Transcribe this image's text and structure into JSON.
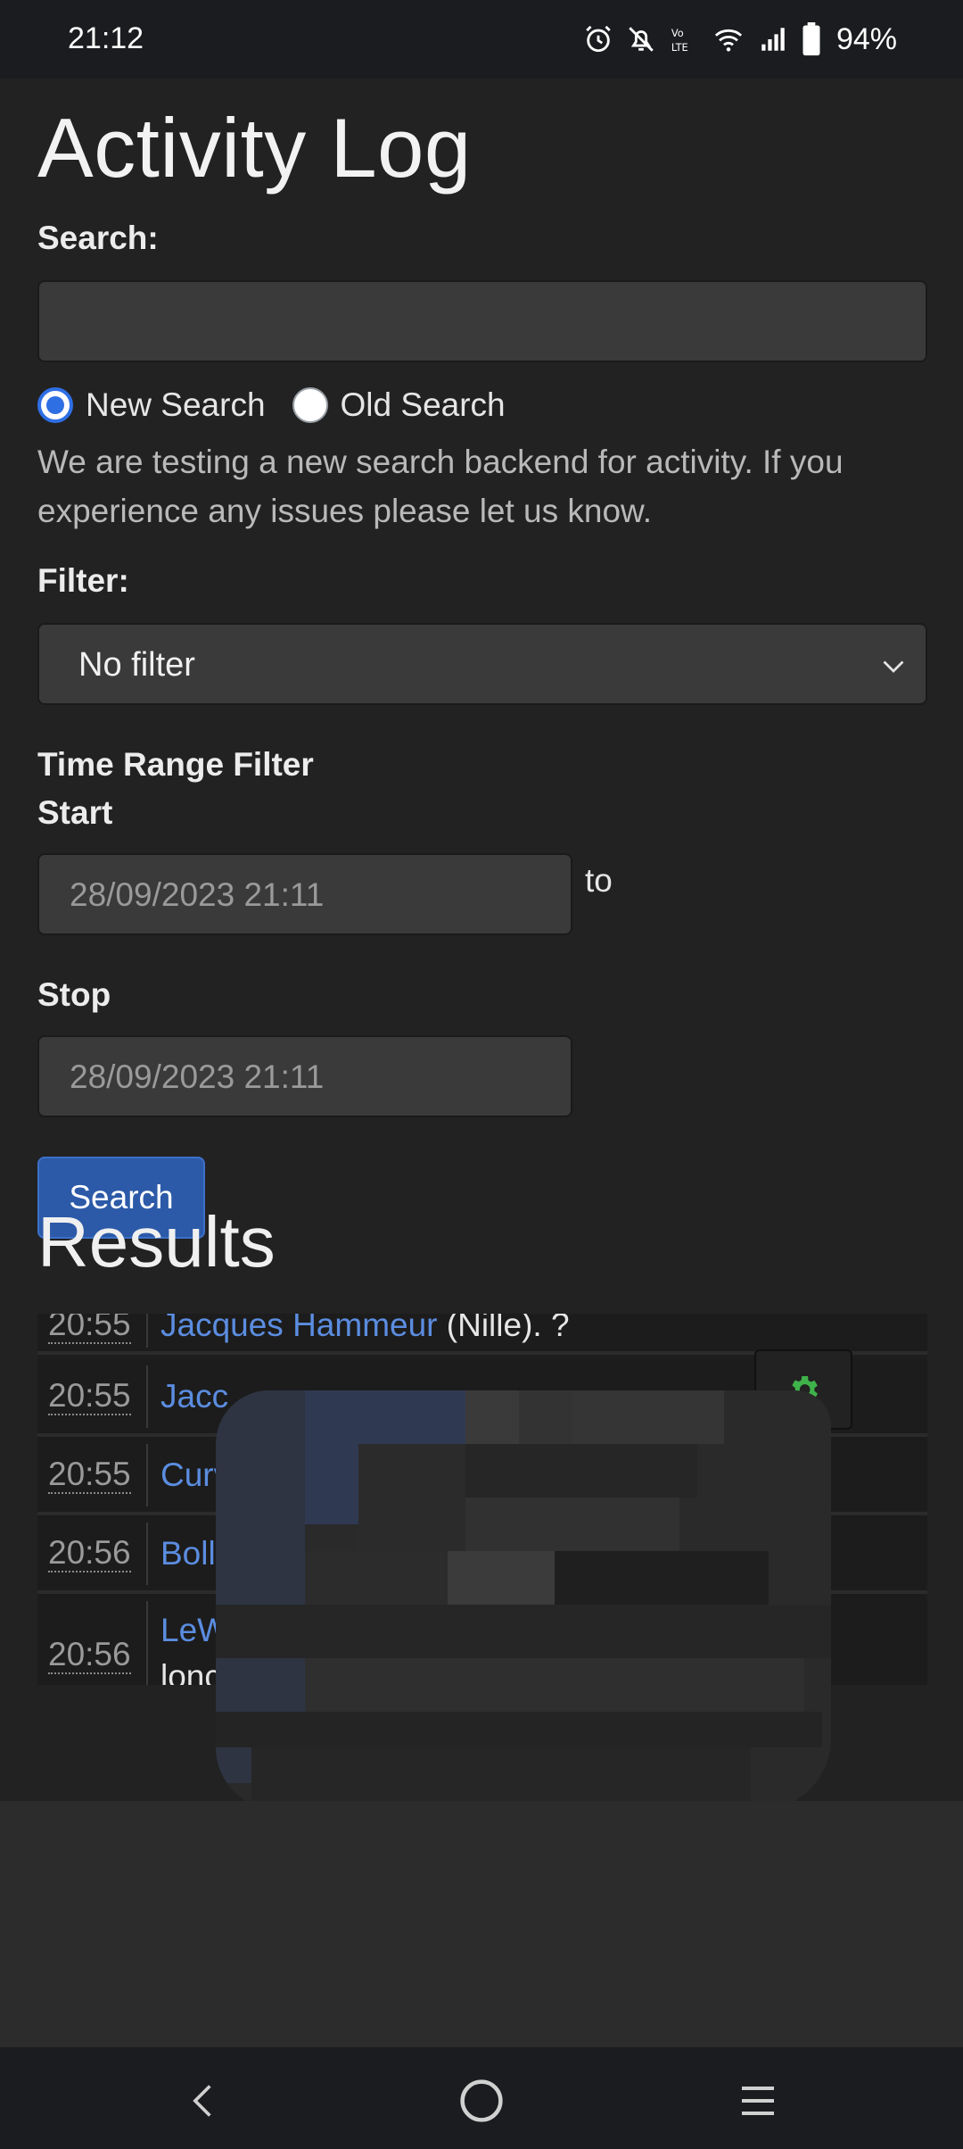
{
  "status_bar": {
    "time": "21:12",
    "battery_percent": "94%",
    "icons": [
      "alarm-icon",
      "mute-icon",
      "volte-icon",
      "wifi-icon",
      "signal-icon",
      "battery-icon"
    ]
  },
  "page": {
    "title": "Activity Log"
  },
  "search": {
    "label": "Search:",
    "value": "",
    "placeholder": "",
    "modes": [
      {
        "label": "New Search",
        "checked": true
      },
      {
        "label": "Old Search",
        "checked": false
      }
    ],
    "help_text": "We are testing a new search backend for activity. If you experience any issues please let us know.",
    "button_label": "Search"
  },
  "filter": {
    "label": "Filter:",
    "selected": "No filter"
  },
  "time_range": {
    "heading": "Time Range Filter",
    "start_label": "Start",
    "start_value": "28/09/2023 21:11",
    "to_text": "to",
    "stop_label": "Stop",
    "stop_value": "28/09/2023 21:11"
  },
  "results": {
    "title": "Results",
    "rows": [
      {
        "time": "20:55",
        "name": "Jacques Hammeur",
        "rest": " (Nille). ?"
      },
      {
        "time": "20:55",
        "name": "Jacc",
        "rest": ""
      },
      {
        "time": "20:55",
        "name": "Curv",
        "rest": ""
      },
      {
        "time": "20:56",
        "name": "Boll",
        "rest": ""
      },
      {
        "time": "20:56",
        "name": "LeW",
        "rest": "",
        "extra": "lonc"
      }
    ]
  },
  "colors": {
    "background": "#222222",
    "link": "#5b8de0",
    "primary_button": "#2c5aa8",
    "radio_accent": "#2f6fe4",
    "gear": "#3fb24a"
  },
  "nav_bar": {
    "icons": [
      "back-icon",
      "home-icon",
      "recents-icon"
    ]
  }
}
